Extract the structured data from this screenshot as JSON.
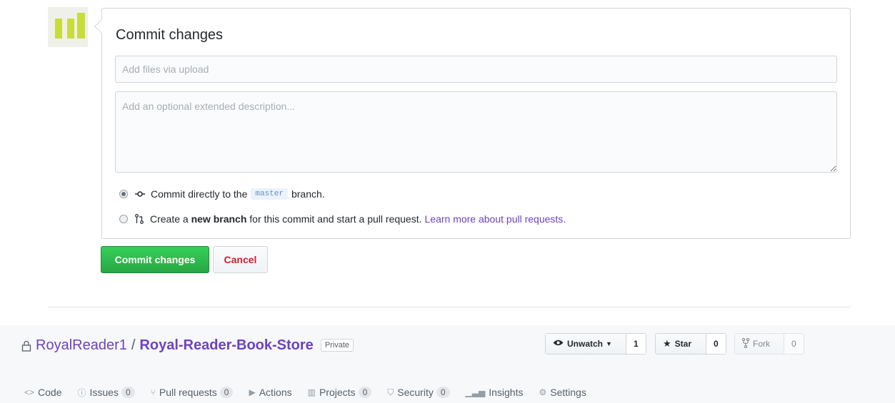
{
  "commit_form": {
    "title": "Commit changes",
    "summary_placeholder": "Add files via upload",
    "summary_value": "",
    "description_placeholder": "Add an optional extended description...",
    "option_direct": {
      "selected": true,
      "text_before": "Commit directly to the",
      "branch": "master",
      "text_after": "branch."
    },
    "option_new_branch": {
      "selected": false,
      "text_before": "Create a",
      "bold": "new branch",
      "text_after": "for this commit and start a pull request.",
      "link": "Learn more about pull requests."
    },
    "commit_button": "Commit changes",
    "cancel_button": "Cancel"
  },
  "repo": {
    "owner": "RoyalReader1",
    "separator": "/",
    "name": "Royal-Reader-Book-Store",
    "visibility": "Private",
    "actions": {
      "unwatch_label": "Unwatch",
      "unwatch_count": "1",
      "star_label": "Star",
      "star_count": "0",
      "fork_label": "Fork",
      "fork_count": "0"
    },
    "tabs": [
      {
        "label": "Code",
        "icon": "code-icon"
      },
      {
        "label": "Issues",
        "count": "0",
        "icon": "issue-icon"
      },
      {
        "label": "Pull requests",
        "count": "0",
        "icon": "pull-request-icon"
      },
      {
        "label": "Actions",
        "icon": "play-icon"
      },
      {
        "label": "Projects",
        "count": "0",
        "icon": "project-icon"
      },
      {
        "label": "Security",
        "count": "0",
        "icon": "shield-icon"
      },
      {
        "label": "Insights",
        "icon": "graph-icon"
      },
      {
        "label": "Settings",
        "icon": "gear-icon"
      }
    ]
  },
  "colors": {
    "primary_green": "#28a745",
    "link_purple": "#6f42c1",
    "cancel_red": "#cb2431",
    "header_bg": "#f6f8fa",
    "avatar_green": "#c8dc3c"
  }
}
